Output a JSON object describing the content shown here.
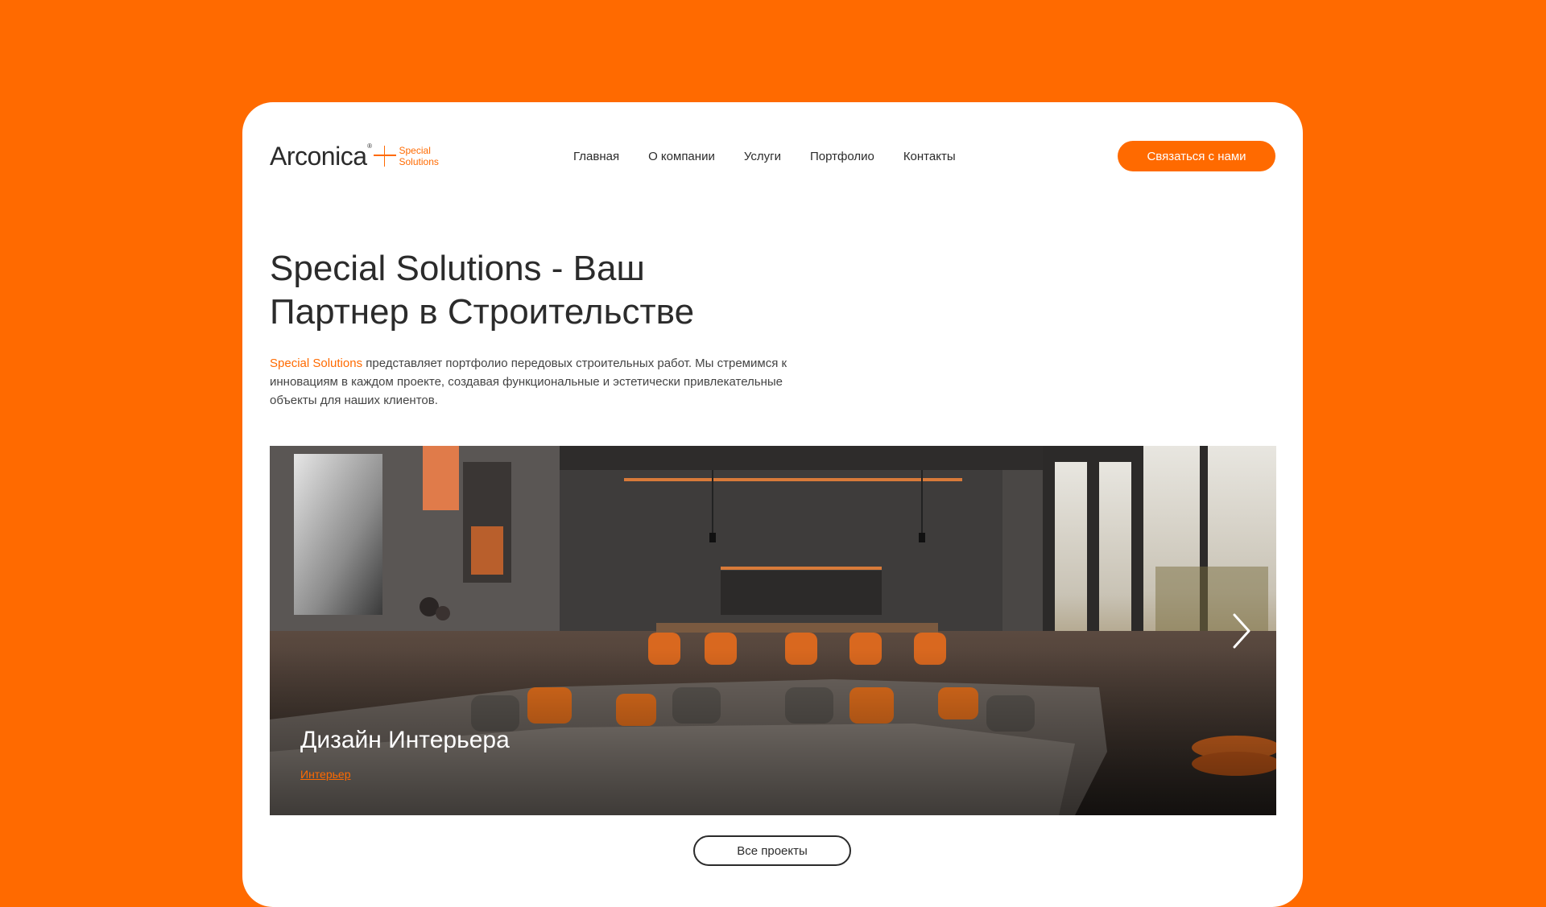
{
  "header": {
    "logo_main": "Arconica",
    "logo_reg": "®",
    "logo_sub_line1": "Special",
    "logo_sub_line2": "Solutions",
    "nav": [
      {
        "label": "Главная"
      },
      {
        "label": "О компании"
      },
      {
        "label": "Услуги"
      },
      {
        "label": "Портфолио"
      },
      {
        "label": "Контакты"
      }
    ],
    "cta_label": "Связаться с нами"
  },
  "hero": {
    "title_line1": "Special Solutions - Ваш",
    "title_line2": "Партнер в Строительстве",
    "desc_accent": "Special Solutions",
    "desc_rest": " представляет портфолио передовых строительных работ. Мы стремимся к инновациям в каждом проекте, создавая функциональные и эстетически привлекательные объекты для наших клиентов."
  },
  "slider": {
    "slide_title": "Дизайн Интерьера",
    "slide_category": "Интерьер",
    "next_icon": "chevron-right-icon"
  },
  "footer_cta": {
    "all_projects_label": "Все проекты"
  },
  "colors": {
    "accent": "#ff6a00",
    "text": "#2b2b2b",
    "background": "#ffffff"
  }
}
